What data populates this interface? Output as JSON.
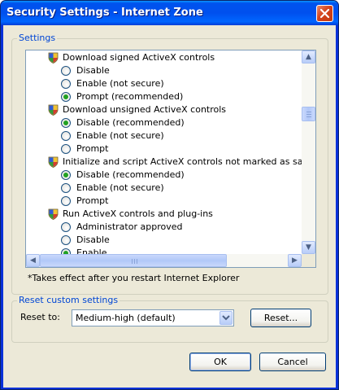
{
  "window": {
    "title": "Security Settings - Internet Zone",
    "close_label": "×"
  },
  "settings_group": {
    "legend": "Settings",
    "list_items": [
      {
        "kind": "heading",
        "label": "Download signed ActiveX controls"
      },
      {
        "kind": "option",
        "label": "Disable",
        "checked": false
      },
      {
        "kind": "option",
        "label": "Enable (not secure)",
        "checked": false
      },
      {
        "kind": "option",
        "label": "Prompt (recommended)",
        "checked": true
      },
      {
        "kind": "heading",
        "label": "Download unsigned ActiveX controls"
      },
      {
        "kind": "option",
        "label": "Disable (recommended)",
        "checked": true
      },
      {
        "kind": "option",
        "label": "Enable (not secure)",
        "checked": false
      },
      {
        "kind": "option",
        "label": "Prompt",
        "checked": false
      },
      {
        "kind": "heading",
        "label": "Initialize and script ActiveX controls not marked as safe for sc"
      },
      {
        "kind": "option",
        "label": "Disable (recommended)",
        "checked": true
      },
      {
        "kind": "option",
        "label": "Enable (not secure)",
        "checked": false
      },
      {
        "kind": "option",
        "label": "Prompt",
        "checked": false
      },
      {
        "kind": "heading",
        "label": "Run ActiveX controls and plug-ins"
      },
      {
        "kind": "option",
        "label": "Administrator approved",
        "checked": false
      },
      {
        "kind": "option",
        "label": "Disable",
        "checked": false
      },
      {
        "kind": "option",
        "label": "Enable",
        "checked": true
      }
    ],
    "scroll": {
      "up_arrow": "▲",
      "down_arrow": "▼",
      "left_arrow": "◀",
      "right_arrow": "▶"
    },
    "note": "*Takes effect after you restart Internet Explorer"
  },
  "reset_group": {
    "legend": "Reset custom settings",
    "reset_to_label": "Reset to:",
    "selected_level": "Medium-high (default)",
    "reset_button": "Reset..."
  },
  "footer": {
    "ok_button": "OK",
    "cancel_button": "Cancel"
  },
  "colors": {
    "titlebar": "#0054e3",
    "dialog_face": "#ece9d8",
    "group_legend": "#0046d5",
    "radio_checked": "#21a121"
  }
}
